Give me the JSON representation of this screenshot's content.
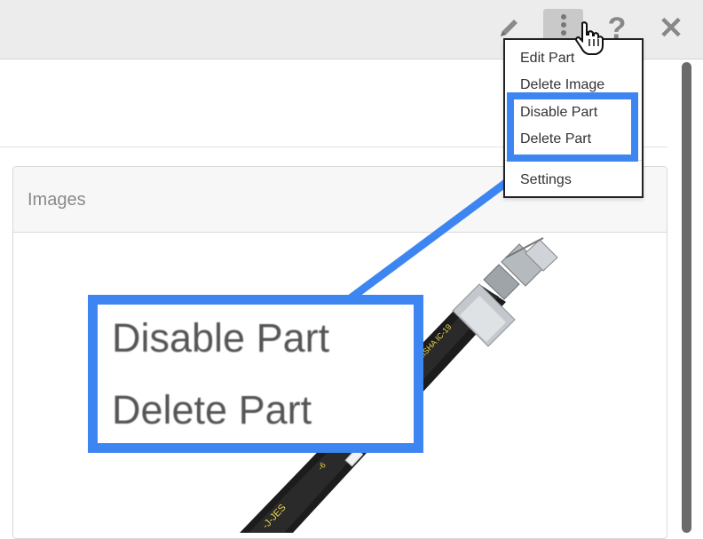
{
  "toolbar": {
    "help_glyph": "?",
    "close_glyph": "✕"
  },
  "panel": {
    "title": "Images"
  },
  "menu": {
    "items": [
      {
        "label": "Edit Part"
      },
      {
        "label": "Delete Image"
      },
      {
        "label": "Disable Part"
      },
      {
        "label": "Delete Part"
      },
      {
        "label": "Settings"
      }
    ]
  },
  "callout": {
    "line1": "Disable Part",
    "line2": "Delete Part"
  },
  "colors": {
    "highlight": "#3d86f2",
    "toolbar_bg": "#ececec"
  },
  "hose_markings": [
    "-J-JES",
    "MSHA IC-19",
    "-6"
  ]
}
